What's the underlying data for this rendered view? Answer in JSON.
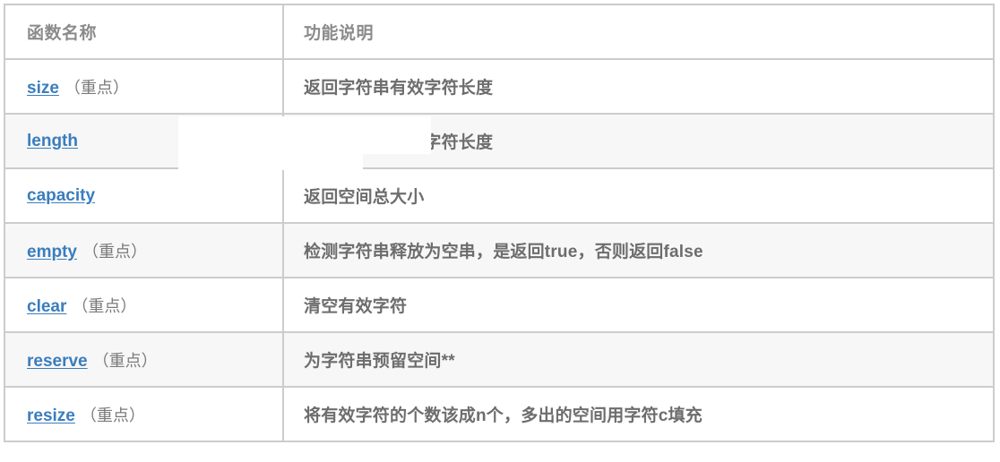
{
  "table": {
    "columns": [
      {
        "key": "name",
        "label": "函数名称"
      },
      {
        "key": "desc",
        "label": "功能说明"
      }
    ],
    "rows": [
      {
        "name": "size",
        "note": "（重点）",
        "desc": "返回字符串有效字符长度",
        "striped": false
      },
      {
        "name": "length",
        "note": "",
        "desc": "返回字符串有效字符长度",
        "striped": true
      },
      {
        "name": "capacity",
        "note": "",
        "desc": "返回空间总大小",
        "striped": false
      },
      {
        "name": "empty",
        "note": "（重点）",
        "desc": "检测字符串释放为空串，是返回true，否则返回false",
        "striped": true
      },
      {
        "name": "clear",
        "note": "（重点）",
        "desc": "清空有效字符",
        "striped": false
      },
      {
        "name": "reserve",
        "note": "（重点）",
        "desc": "为字符串预留空间**",
        "striped": true
      },
      {
        "name": "resize",
        "note": "（重点）",
        "desc": "将有效字符的个数该成n个，多出的空间用字符c填充",
        "striped": false
      }
    ]
  },
  "colors": {
    "link": "#3a7dbd",
    "header_text": "#8b8b8b",
    "body_text": "#6d6d6d",
    "note_text": "#7a7a7a",
    "border": "#cccccc",
    "stripe": "#f7f7f7",
    "background": "#ffffff"
  }
}
